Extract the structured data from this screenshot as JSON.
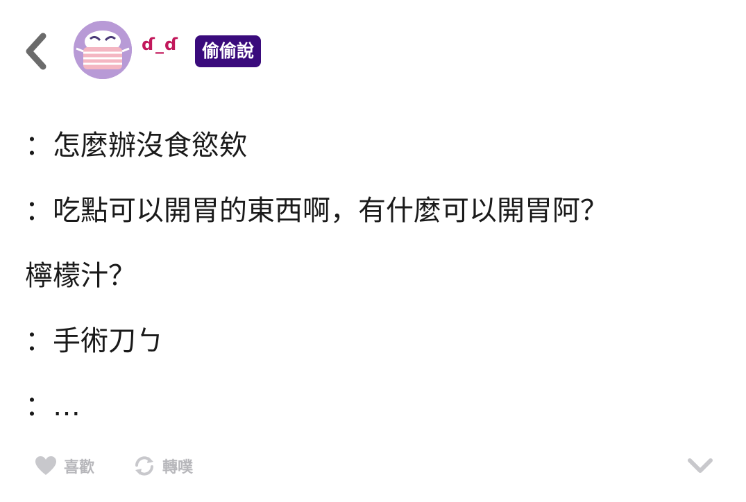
{
  "header": {
    "username": "ɗ_ɗ",
    "badge": "偷偷說"
  },
  "post": {
    "lines": [
      "：怎麼辦沒食慾欸",
      "：吃點可以開胃的東西啊，有什麼可以開胃阿？",
      "檸檬汁？",
      "：手術刀ㄅ",
      "：…"
    ]
  },
  "footer": {
    "like_label": "喜歡",
    "repost_label": "轉噗"
  },
  "icons": {
    "back": "chevron-left-icon",
    "avatar": "masked-face-icon",
    "like": "heart-icon",
    "repost": "repost-icon",
    "expand": "chevron-down-icon"
  },
  "colors": {
    "username": "#c2185b",
    "badge_bg": "#3a0b7c",
    "badge_text": "#ffffff",
    "text": "#1a1a1a",
    "muted": "#b7b7bb",
    "icon_gray": "#c8c8cc",
    "back_icon": "#6b6b6b",
    "avatar_bg": "#b89ad6"
  }
}
